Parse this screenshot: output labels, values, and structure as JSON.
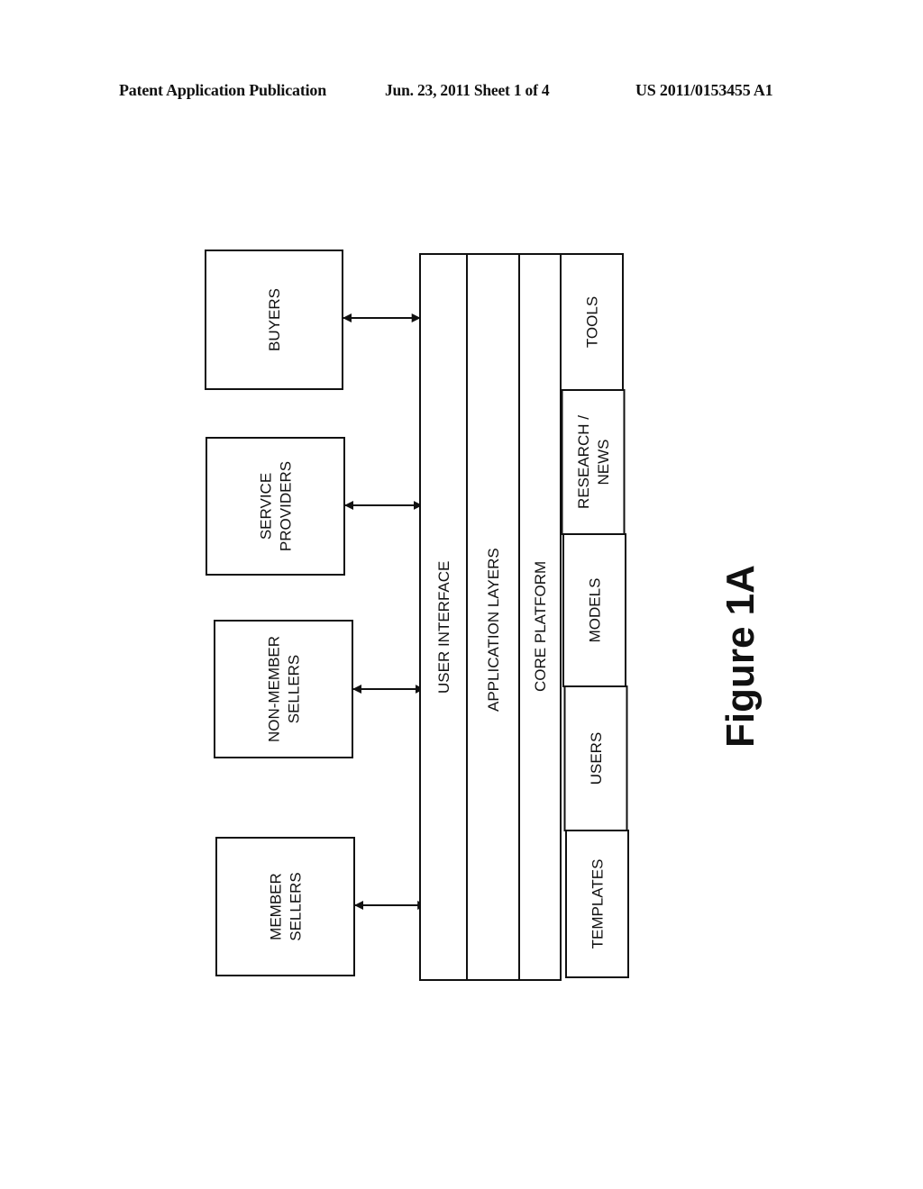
{
  "header": {
    "left": "Patent Application Publication",
    "middle": "Jun. 23, 2011   Sheet 1 of 4",
    "right": "US 2011/0153455 A1"
  },
  "entities": [
    {
      "id": "buyers",
      "lines": [
        "BUYERS"
      ]
    },
    {
      "id": "service-providers",
      "lines": [
        "SERVICE",
        "PROVIDERS"
      ]
    },
    {
      "id": "non-member-sellers",
      "lines": [
        "NON-MEMBER",
        "SELLERS"
      ]
    },
    {
      "id": "member-sellers",
      "lines": [
        "MEMBER",
        "SELLERS"
      ]
    }
  ],
  "layers": [
    {
      "id": "user-interface",
      "label": "USER INTERFACE"
    },
    {
      "id": "application-layers",
      "label": "APPLICATION LAYERS"
    },
    {
      "id": "core-platform",
      "label": "CORE PLATFORM"
    }
  ],
  "modules": [
    {
      "id": "tools",
      "lines": [
        "TOOLS"
      ]
    },
    {
      "id": "research-news",
      "lines": [
        "RESEARCH /",
        "NEWS"
      ]
    },
    {
      "id": "models",
      "lines": [
        "MODELS"
      ]
    },
    {
      "id": "users",
      "lines": [
        "USERS"
      ]
    },
    {
      "id": "templates",
      "lines": [
        "TEMPLATES"
      ]
    }
  ],
  "figure_label": "Figure 1A",
  "colors": {
    "stroke": "#111111",
    "background": "#ffffff"
  }
}
